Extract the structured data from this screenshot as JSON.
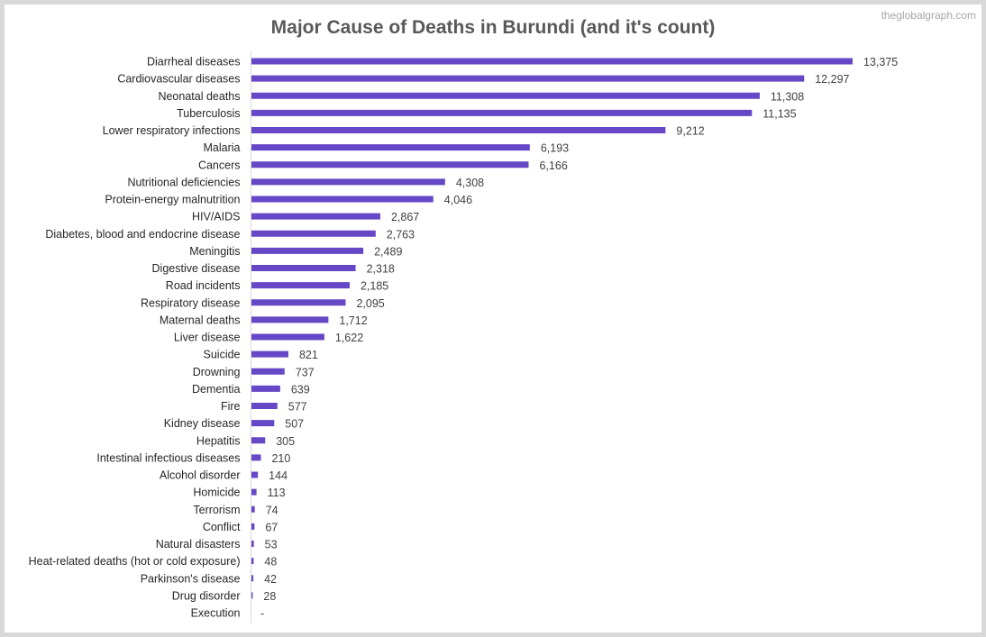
{
  "watermark": "theglobalgraph.com",
  "chart_data": {
    "type": "bar",
    "orientation": "horizontal",
    "title": "Major Cause of Deaths in Burundi (and it's count)",
    "xlabel": "",
    "ylabel": "",
    "xlim": [
      0,
      13375
    ],
    "grid": false,
    "legend": null,
    "bar_color": "#6647c6",
    "categories": [
      "Diarrheal diseases",
      "Cardiovascular diseases",
      "Neonatal deaths",
      "Tuberculosis",
      "Lower respiratory infections",
      "Malaria",
      "Cancers",
      "Nutritional deficiencies",
      "Protein-energy malnutrition",
      "HIV/AIDS",
      "Diabetes, blood and endocrine disease",
      "Meningitis",
      "Digestive disease",
      "Road incidents",
      "Respiratory disease",
      "Maternal deaths",
      "Liver disease",
      "Suicide",
      "Drowning",
      "Dementia",
      "Fire",
      "Kidney disease",
      "Hepatitis",
      "Intestinal infectious diseases",
      "Alcohol disorder",
      "Homicide",
      "Terrorism",
      "Conflict",
      "Natural disasters",
      "Heat-related deaths (hot or cold exposure)",
      "Parkinson's disease",
      "Drug disorder",
      "Execution"
    ],
    "values": [
      13375,
      12297,
      11308,
      11135,
      9212,
      6193,
      6166,
      4308,
      4046,
      2867,
      2763,
      2489,
      2318,
      2185,
      2095,
      1712,
      1622,
      821,
      737,
      639,
      577,
      507,
      305,
      210,
      144,
      113,
      74,
      67,
      53,
      48,
      42,
      28,
      0
    ],
    "data_labels": [
      "13,375",
      "12,297",
      "11,308",
      "11,135",
      "9,212",
      "6,193",
      "6,166",
      "4,308",
      "4,046",
      "2,867",
      "2,763",
      "2,489",
      "2,318",
      "2,185",
      "2,095",
      "1,712",
      "1,622",
      "821",
      "737",
      "639",
      "577",
      "507",
      "305",
      "210",
      "144",
      "113",
      "74",
      "67",
      "53",
      "48",
      "42",
      "28",
      "-"
    ]
  }
}
